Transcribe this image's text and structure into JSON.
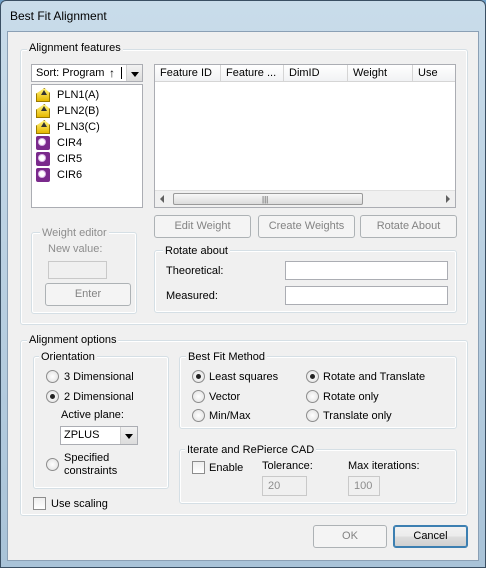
{
  "window": {
    "title": "Best Fit Alignment"
  },
  "features": {
    "group_title": "Alignment features",
    "sort_label": "Sort: Program",
    "sort_arrow": "↑",
    "items": [
      {
        "label": "PLN1(A)",
        "icon": "plane-icon"
      },
      {
        "label": "PLN2(B)",
        "icon": "plane-icon"
      },
      {
        "label": "PLN3(C)",
        "icon": "plane-icon"
      },
      {
        "label": "CIR4",
        "icon": "circle-icon"
      },
      {
        "label": "CIR5",
        "icon": "circle-icon"
      },
      {
        "label": "CIR6",
        "icon": "circle-icon"
      }
    ],
    "columns": [
      "Feature ID",
      "Feature ...",
      "DimID",
      "Weight",
      "Use"
    ],
    "thumb_grip": "|||",
    "buttons": {
      "edit_weight": "Edit Weight",
      "create_weights": "Create Weights",
      "rotate_about": "Rotate About"
    },
    "weight_editor": {
      "title": "Weight editor",
      "new_value_label": "New value:",
      "enter": "Enter"
    },
    "rotate_about": {
      "title": "Rotate about",
      "theoretical": "Theoretical:",
      "measured": "Measured:"
    }
  },
  "options": {
    "group_title": "Alignment options",
    "orientation": {
      "title": "Orientation",
      "three_d": "3 Dimensional",
      "two_d": "2 Dimensional",
      "selected": "2 Dimensional",
      "active_plane_label": "Active plane:",
      "active_plane": "ZPLUS",
      "specified_1": "Specified",
      "specified_2": "constraints"
    },
    "best_fit": {
      "title": "Best Fit Method",
      "least_squares": "Least squares",
      "vector": "Vector",
      "minmax": "Min/Max",
      "rotate_translate": "Rotate and Translate",
      "rotate_only": "Rotate only",
      "translate_only": "Translate only",
      "selected_method": "Least squares",
      "selected_mode": "Rotate and Translate"
    },
    "iterate": {
      "title": "Iterate and RePierce CAD",
      "enable": "Enable",
      "tolerance_label": "Tolerance:",
      "tolerance": "20",
      "max_iter_label": "Max iterations:",
      "max_iter": "100"
    },
    "use_scaling": "Use scaling"
  },
  "footer": {
    "ok": "OK",
    "cancel": "Cancel"
  }
}
